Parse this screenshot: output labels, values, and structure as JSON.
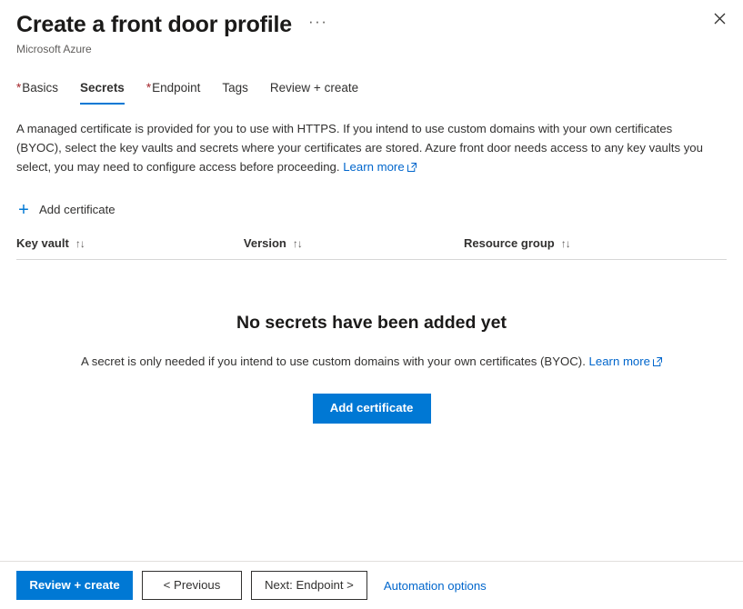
{
  "header": {
    "title": "Create a front door profile",
    "subtitle": "Microsoft Azure",
    "more_label": "···",
    "close_label": "Close"
  },
  "tabs": [
    {
      "label": "Basics",
      "required": "*",
      "active": false
    },
    {
      "label": "Secrets",
      "required": "",
      "active": true
    },
    {
      "label": "Endpoint",
      "required": "*",
      "active": false
    },
    {
      "label": "Tags",
      "required": "",
      "active": false
    },
    {
      "label": "Review + create",
      "required": "",
      "active": false
    }
  ],
  "description": {
    "text": "A managed certificate is provided for you to use with HTTPS. If you intend to use custom domains with your own certificates (BYOC), select the key vaults and secrets where your certificates are stored. Azure front door needs access to any key vaults you select, you may need to configure access before proceeding.",
    "learn_more": "Learn more"
  },
  "command_bar": {
    "add_certificate": "Add certificate",
    "plus_glyph": "+"
  },
  "table": {
    "columns": [
      {
        "label": "Key vault",
        "sort_glyph": "↑↓"
      },
      {
        "label": "Version",
        "sort_glyph": "↑↓"
      },
      {
        "label": "Resource group",
        "sort_glyph": "↑↓"
      }
    ],
    "rows": []
  },
  "empty_state": {
    "title": "No secrets have been added yet",
    "subtitle": "A secret is only needed if you intend to use custom domains with your own certificates (BYOC).",
    "learn_more": "Learn more",
    "button_label": "Add certificate"
  },
  "footer": {
    "review_create": "Review + create",
    "previous": "< Previous",
    "next": "Next: Endpoint >",
    "automation_options": "Automation options"
  },
  "colors": {
    "accent": "#0078d4",
    "link": "#0066cc",
    "required_asterisk": "#a4262c",
    "text": "#323130",
    "divider": "#d6d6d6"
  }
}
